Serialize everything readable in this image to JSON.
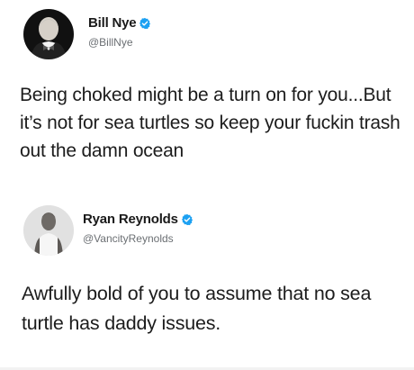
{
  "tweets": [
    {
      "author": "Bill Nye",
      "handle": "@BillNye",
      "verified": true,
      "avatar_icon": "person-portrait-bowtie",
      "text": "Being choked might be a turn on for you...But it’s not for sea turtles so keep your fuckin trash out the damn ocean"
    },
    {
      "author": "Ryan Reynolds",
      "handle": "@VancityReynolds",
      "verified": true,
      "avatar_icon": "person-portrait-tshirt",
      "text": "Awfully bold of you to assume that no sea turtle has daddy issues."
    }
  ],
  "colors": {
    "verified_badge": "#1da1f2",
    "text": "#1c1c1c",
    "handle": "#6b6f73"
  }
}
